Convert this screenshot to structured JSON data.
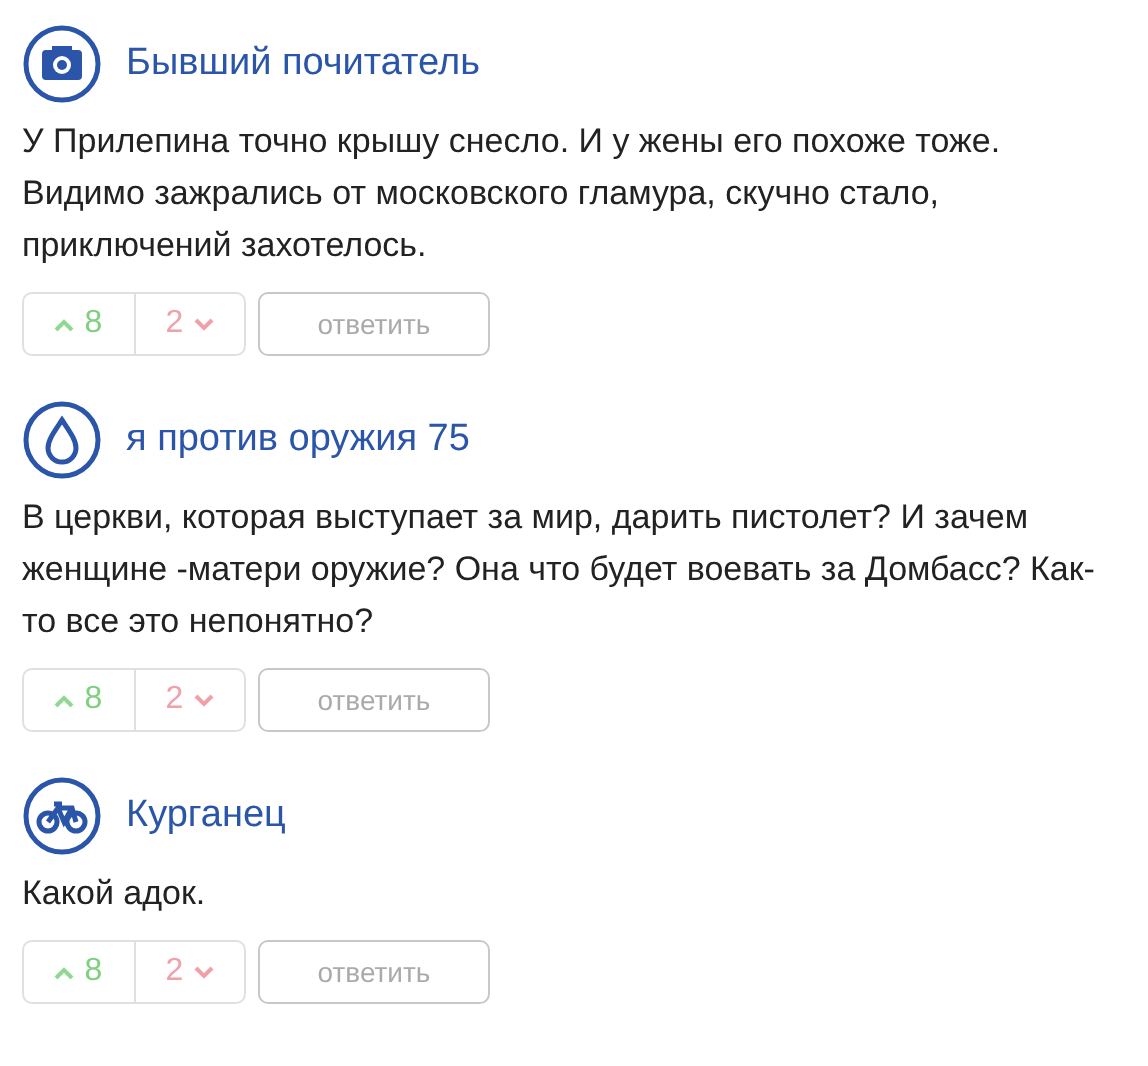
{
  "comments": [
    {
      "kind": "camera",
      "author": "Бывший почитатель",
      "text": "У Прилепина точно крышу снесло. И у жены его похоже тоже. Видимо зажрались от московского гламура, скучно стало, приключений захотелось.",
      "up": "8",
      "down": "2",
      "reply": "ответить"
    },
    {
      "kind": "drop",
      "author": "я против оружия 75",
      "text": "В церкви, которая выступает за мир, дарить пистолет? И зачем женщине -матери оружие? Она что будет воевать за Домбасс? Как-то все это непонятно?",
      "up": "8",
      "down": "2",
      "reply": "ответить"
    },
    {
      "kind": "bike",
      "author": "Курганец",
      "text": "Какой адок.",
      "up": "8",
      "down": "2",
      "reply": "ответить"
    }
  ]
}
